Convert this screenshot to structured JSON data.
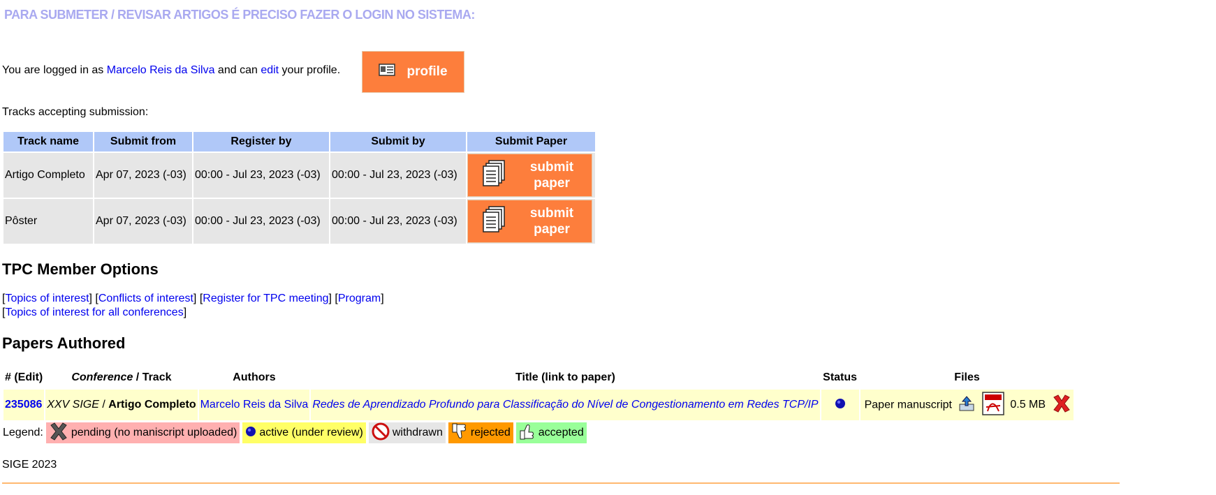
{
  "banner": "PARA SUBMETER / REVISAR ARTIGOS É PRECISO FAZER O LOGIN NO SISTEMA:",
  "login": {
    "prefix": "You are logged in as ",
    "user": "Marcelo Reis da Silva",
    "middle": " and can ",
    "edit": "edit",
    "suffix": " your profile.",
    "profile_button": "profile"
  },
  "tracks": {
    "label": "Tracks accepting submission:",
    "headers": [
      "Track name",
      "Submit from",
      "Register by",
      "Submit by",
      "Submit Paper"
    ],
    "rows": [
      {
        "name": "Artigo Completo",
        "from": "Apr 07, 2023 (-03)",
        "register": "00:00 - Jul 23, 2023 (-03)",
        "submit": "00:00 - Jul 23, 2023 (-03)"
      },
      {
        "name": "Pôster",
        "from": "Apr 07, 2023 (-03)",
        "register": "00:00 - Jul 23, 2023 (-03)",
        "submit": "00:00 - Jul 23, 2023 (-03)"
      }
    ],
    "submit_line1": "submit",
    "submit_line2": "paper"
  },
  "tpc": {
    "title": "TPC Member Options",
    "links": [
      "Topics of interest",
      "Conflicts of interest",
      "Register for TPC meeting",
      "Program"
    ],
    "link_all": "Topics of interest for all conferences"
  },
  "papers": {
    "title": "Papers Authored",
    "headers": {
      "id": "# (Edit)",
      "conference": "Conference",
      "slash": " / ",
      "track": "Track",
      "authors": "Authors",
      "title": "Title (link to paper)",
      "status": "Status",
      "files": "Files"
    },
    "rows": [
      {
        "id": "235086",
        "conference": "XXV SIGE",
        "track": "Artigo Completo",
        "authors": "Marcelo Reis da Silva",
        "title": "Redes de Aprendizado Profundo para Classificação do Nível de Congestionamento em Redes TCP/IP",
        "file_label": "Paper manuscript",
        "file_size": "0.5 MB"
      }
    ]
  },
  "legend": {
    "label": "Legend:",
    "items": [
      {
        "text": "pending (no maniscript uploaded)",
        "color": "#ffb0b0",
        "icon": "x-icon"
      },
      {
        "text": "active (under review)",
        "color": "#ffff66",
        "icon": "blue-dot-icon"
      },
      {
        "text": "withdrawn",
        "color": "#e6e6e6",
        "icon": "no-entry-icon"
      },
      {
        "text": "rejected",
        "color": "#ff9900",
        "icon": "thumbs-down-icon"
      },
      {
        "text": "accepted",
        "color": "#99ff99",
        "icon": "thumbs-up-icon"
      }
    ]
  },
  "footer": "SIGE 2023"
}
